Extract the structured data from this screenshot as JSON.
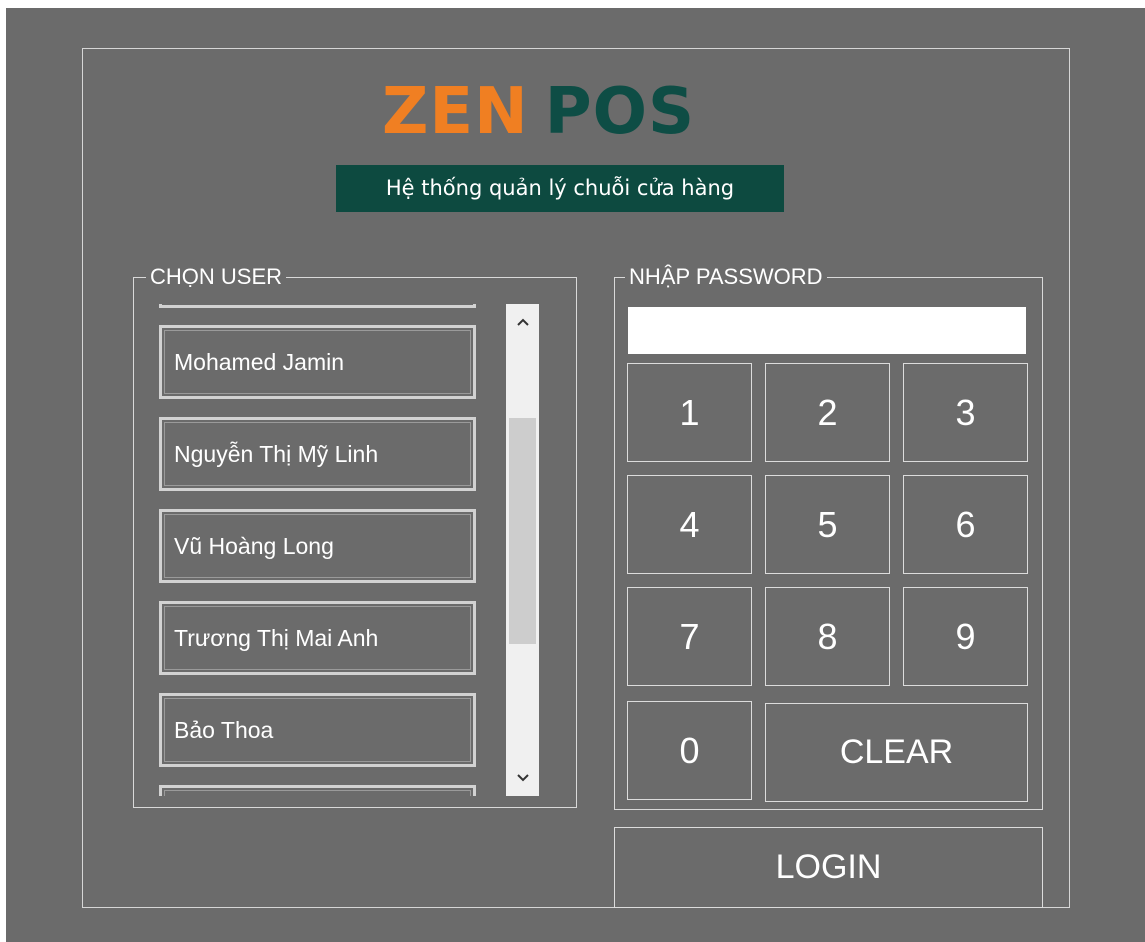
{
  "logo": {
    "zen": "ZEN",
    "pos": "POS",
    "tagline": "Hệ thống quản lý chuỗi cửa hàng"
  },
  "user_section": {
    "legend": "CHỌN USER",
    "users": [
      "Mohamed Jamin",
      "Nguyễn Thị Mỹ Linh",
      "Vũ Hoàng Long",
      "Trương Thị Mai Anh",
      "Bảo Thoa"
    ]
  },
  "scrollbar": {
    "up_icon": "▲",
    "down_icon": "▼"
  },
  "password_section": {
    "legend": "NHẬP PASSWORD",
    "value": "",
    "keys": [
      "1",
      "2",
      "3",
      "4",
      "5",
      "6",
      "7",
      "8",
      "9",
      "0"
    ],
    "clear_label": "CLEAR"
  },
  "login_label": "LOGIN",
  "colors": {
    "background": "#6b6b6b",
    "zen_orange": "#f07f22",
    "pos_green": "#0e4d45",
    "tagline_bg": "#0d4a40"
  }
}
